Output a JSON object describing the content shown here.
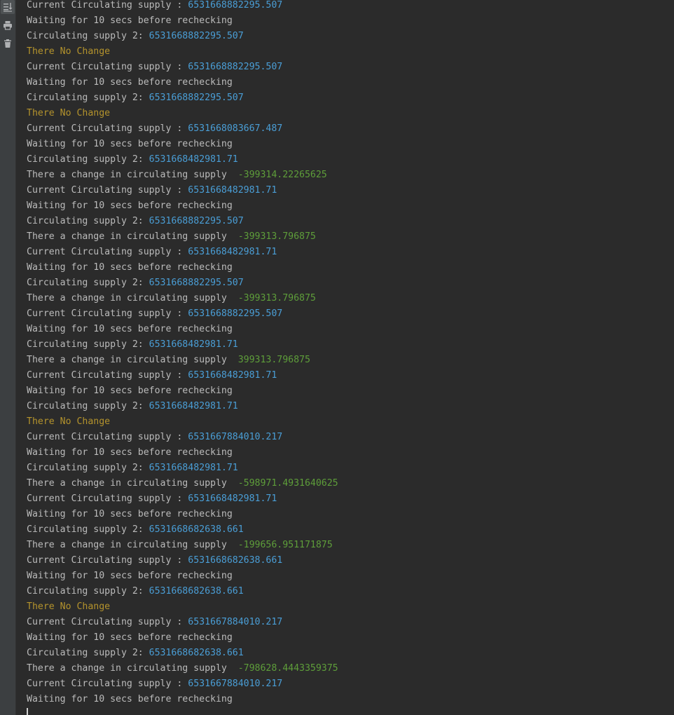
{
  "toolbar": {
    "icons": [
      "scroll-to-end-icon",
      "print-icon",
      "trash-icon"
    ]
  },
  "console": {
    "lines": [
      {
        "kind": "current",
        "text": "Current Circulating supply : ",
        "value": "6531668882295.507"
      },
      {
        "kind": "waiting",
        "text": "Waiting for 10 secs before rechecking",
        "value": ""
      },
      {
        "kind": "supply2",
        "text": "Circulating supply 2: ",
        "value": "6531668882295.507"
      },
      {
        "kind": "nochange",
        "text": "There No Change",
        "value": ""
      },
      {
        "kind": "current",
        "text": "Current Circulating supply : ",
        "value": "6531668882295.507"
      },
      {
        "kind": "waiting",
        "text": "Waiting for 10 secs before rechecking",
        "value": ""
      },
      {
        "kind": "supply2",
        "text": "Circulating supply 2: ",
        "value": "6531668882295.507"
      },
      {
        "kind": "nochange",
        "text": "There No Change",
        "value": ""
      },
      {
        "kind": "current",
        "text": "Current Circulating supply : ",
        "value": "6531668083667.487"
      },
      {
        "kind": "waiting",
        "text": "Waiting for 10 secs before rechecking",
        "value": ""
      },
      {
        "kind": "supply2",
        "text": "Circulating supply 2: ",
        "value": "6531668482981.71"
      },
      {
        "kind": "change",
        "text": "There a change in circulating supply  ",
        "value": "-399314.22265625"
      },
      {
        "kind": "current",
        "text": "Current Circulating supply : ",
        "value": "6531668482981.71"
      },
      {
        "kind": "waiting",
        "text": "Waiting for 10 secs before rechecking",
        "value": ""
      },
      {
        "kind": "supply2",
        "text": "Circulating supply 2: ",
        "value": "6531668882295.507"
      },
      {
        "kind": "change",
        "text": "There a change in circulating supply  ",
        "value": "-399313.796875"
      },
      {
        "kind": "current",
        "text": "Current Circulating supply : ",
        "value": "6531668482981.71"
      },
      {
        "kind": "waiting",
        "text": "Waiting for 10 secs before rechecking",
        "value": ""
      },
      {
        "kind": "supply2",
        "text": "Circulating supply 2: ",
        "value": "6531668882295.507"
      },
      {
        "kind": "change",
        "text": "There a change in circulating supply  ",
        "value": "-399313.796875"
      },
      {
        "kind": "current",
        "text": "Current Circulating supply : ",
        "value": "6531668882295.507"
      },
      {
        "kind": "waiting",
        "text": "Waiting for 10 secs before rechecking",
        "value": ""
      },
      {
        "kind": "supply2",
        "text": "Circulating supply 2: ",
        "value": "6531668482981.71"
      },
      {
        "kind": "change",
        "text": "There a change in circulating supply  ",
        "value": "399313.796875"
      },
      {
        "kind": "current",
        "text": "Current Circulating supply : ",
        "value": "6531668482981.71"
      },
      {
        "kind": "waiting",
        "text": "Waiting for 10 secs before rechecking",
        "value": ""
      },
      {
        "kind": "supply2",
        "text": "Circulating supply 2: ",
        "value": "6531668482981.71"
      },
      {
        "kind": "nochange",
        "text": "There No Change",
        "value": ""
      },
      {
        "kind": "current",
        "text": "Current Circulating supply : ",
        "value": "6531667884010.217"
      },
      {
        "kind": "waiting",
        "text": "Waiting for 10 secs before rechecking",
        "value": ""
      },
      {
        "kind": "supply2",
        "text": "Circulating supply 2: ",
        "value": "6531668482981.71"
      },
      {
        "kind": "change",
        "text": "There a change in circulating supply  ",
        "value": "-598971.4931640625"
      },
      {
        "kind": "current",
        "text": "Current Circulating supply : ",
        "value": "6531668482981.71"
      },
      {
        "kind": "waiting",
        "text": "Waiting for 10 secs before rechecking",
        "value": ""
      },
      {
        "kind": "supply2",
        "text": "Circulating supply 2: ",
        "value": "6531668682638.661"
      },
      {
        "kind": "change",
        "text": "There a change in circulating supply  ",
        "value": "-199656.951171875"
      },
      {
        "kind": "current",
        "text": "Current Circulating supply : ",
        "value": "6531668682638.661"
      },
      {
        "kind": "waiting",
        "text": "Waiting for 10 secs before rechecking",
        "value": ""
      },
      {
        "kind": "supply2",
        "text": "Circulating supply 2: ",
        "value": "6531668682638.661"
      },
      {
        "kind": "nochange",
        "text": "There No Change",
        "value": ""
      },
      {
        "kind": "current",
        "text": "Current Circulating supply : ",
        "value": "6531667884010.217"
      },
      {
        "kind": "waiting",
        "text": "Waiting for 10 secs before rechecking",
        "value": ""
      },
      {
        "kind": "supply2",
        "text": "Circulating supply 2: ",
        "value": "6531668682638.661"
      },
      {
        "kind": "change",
        "text": "There a change in circulating supply  ",
        "value": "-798628.4443359375"
      },
      {
        "kind": "current",
        "text": "Current Circulating supply : ",
        "value": "6531667884010.217"
      },
      {
        "kind": "waiting",
        "text": "Waiting for 10 secs before rechecking",
        "value": ""
      }
    ]
  },
  "colors": {
    "background": "#2b2b2b",
    "text": "#bbbbbb",
    "number": "#4a9ed6",
    "change": "#5e9e3a",
    "no_change": "#b4932c"
  }
}
